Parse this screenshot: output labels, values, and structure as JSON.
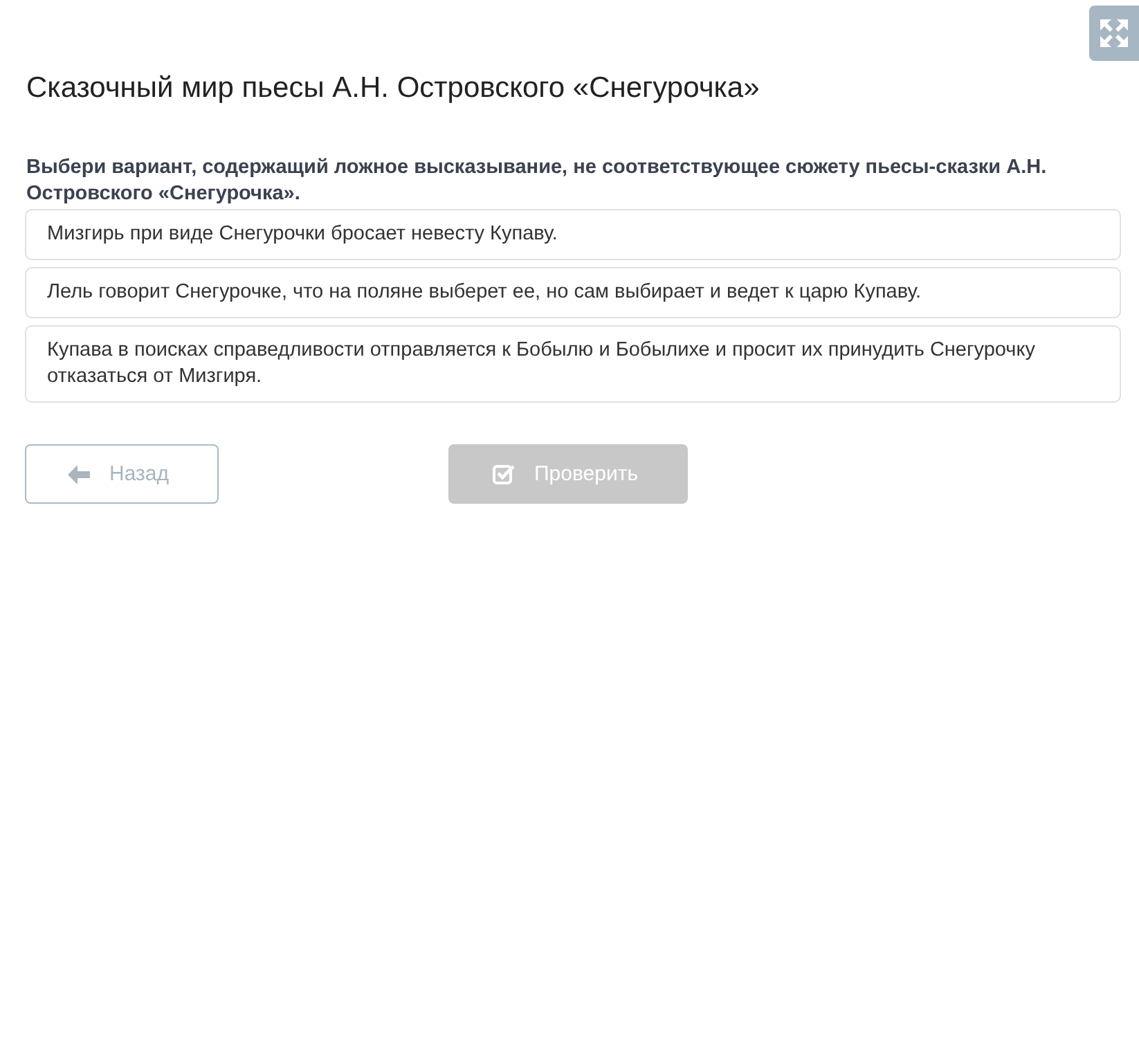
{
  "title": "Сказочный мир пьесы А.Н. Островского «Снегурочка»",
  "question": "Выбери вариант, содержащий ложное высказывание, не соответствующее сюжету пьесы-сказки А.Н. Островского «Снегурочка».",
  "options": [
    {
      "text": "Мизгирь при виде Снегурочки бросает невесту Купаву.",
      "selected": false
    },
    {
      "text": "Лель говорит Снегурочке, что на поляне выберет ее, но сам выбирает и ведет к царю Купаву.",
      "selected": false
    },
    {
      "text": "Купава в поисках справедливости отправляется к Бобылю и Бобылихе и просит их принудить Снегурочку отказаться от Мизгиря.",
      "selected": false
    }
  ],
  "buttons": [
    {
      "kind": "back",
      "label": "Назад",
      "disabled": false
    },
    {
      "kind": "check",
      "label": "Проверить",
      "disabled": true
    }
  ]
}
